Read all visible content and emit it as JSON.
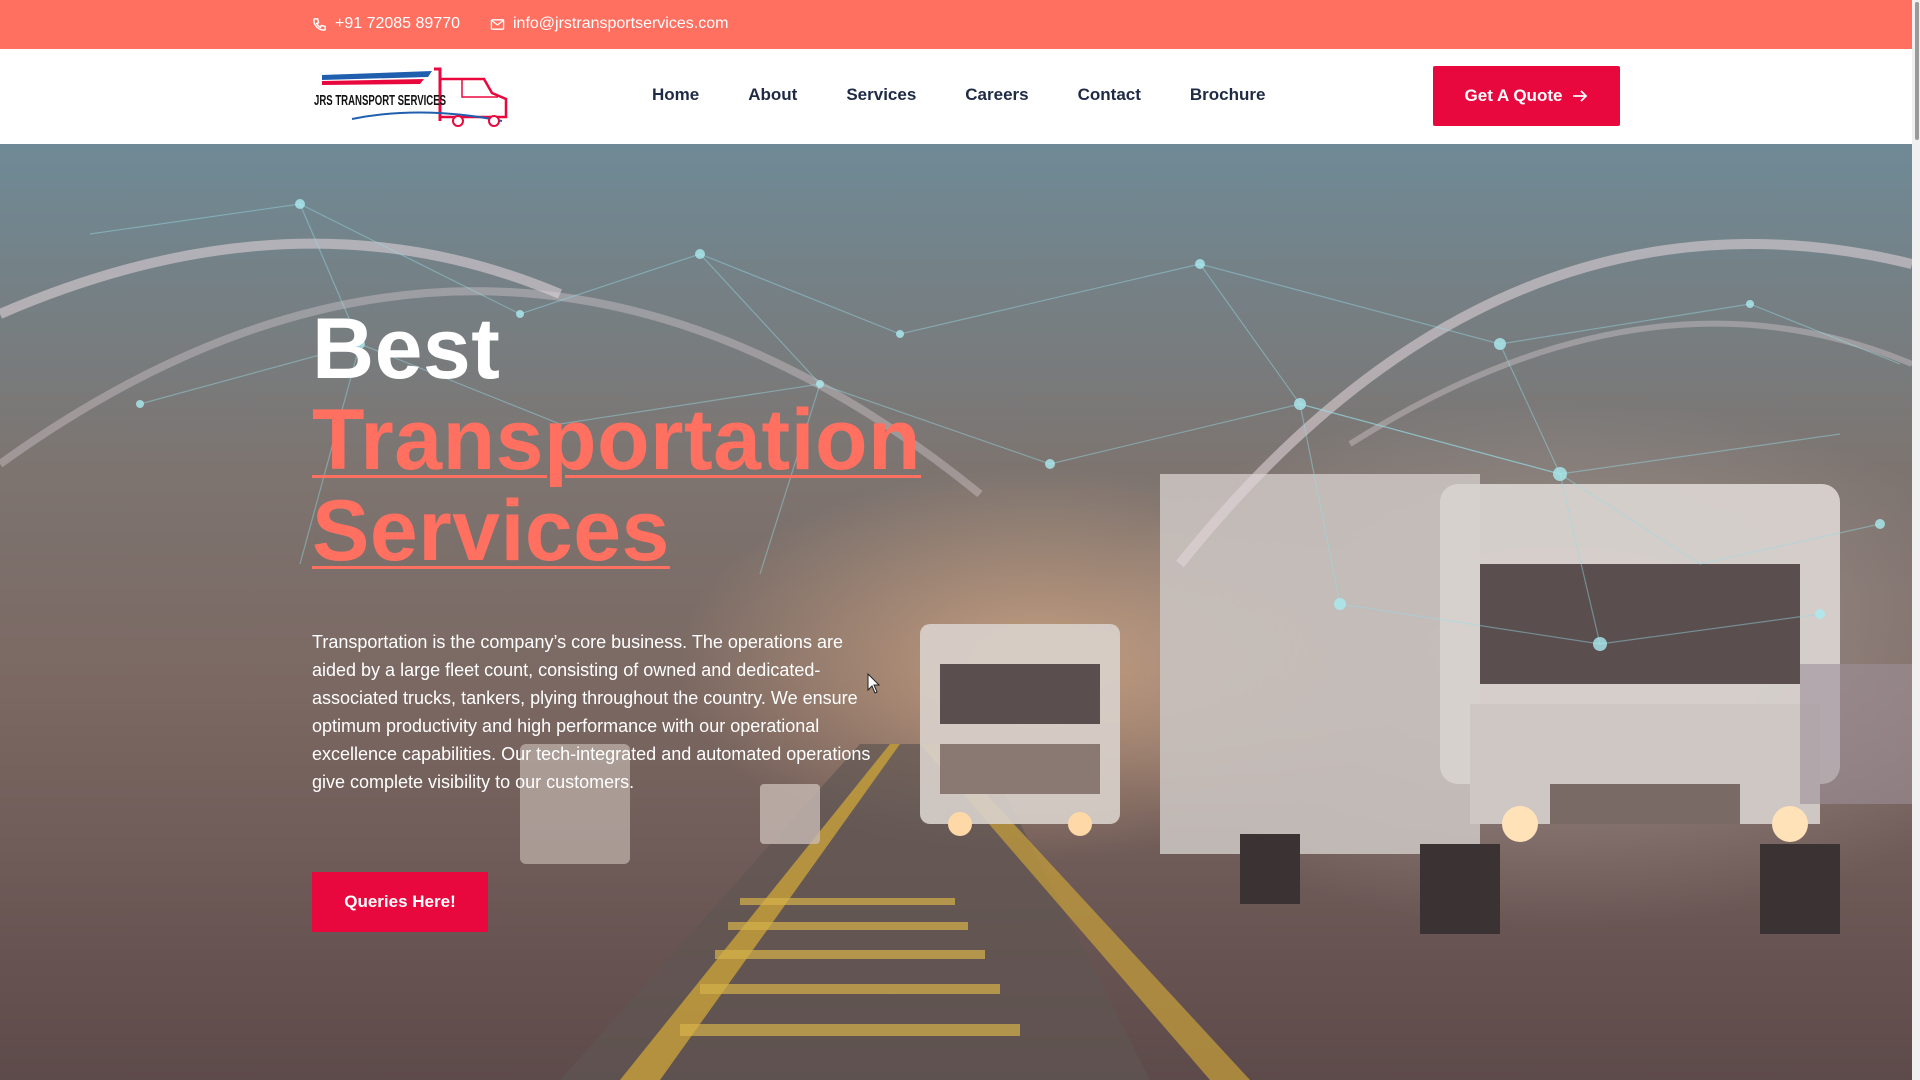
{
  "topbar": {
    "phone": "+91 72085 89770",
    "email": "info@jrstransportservices.com"
  },
  "header": {
    "logo_text": "JRS TRANSPORT SERVICES",
    "nav": [
      {
        "label": "Home"
      },
      {
        "label": "About"
      },
      {
        "label": "Services"
      },
      {
        "label": "Careers"
      },
      {
        "label": "Contact"
      },
      {
        "label": "Brochure"
      }
    ],
    "quote_button": "Get A Quote"
  },
  "hero": {
    "title_line1": "Best",
    "title_accent_line1": "Transportation",
    "title_accent_line2": "Services",
    "description": "Transportation is the company’s core business. The operations are aided by a large fleet count, consisting of owned and dedicated-associated trucks, tankers, plying throughout the country. We ensure optimum productivity and high performance with our operational excellence capabilities. Our tech-integrated and automated operations give complete visibility to our customers.",
    "cta_button": "Queries Here!"
  },
  "colors": {
    "topbar": "#ff7061",
    "accent": "#ff7061",
    "button": "#e8083e",
    "nav_text": "#1f2a44"
  },
  "icons": {
    "phone": "phone-icon",
    "email": "mail-icon",
    "quote_arrow": "arrow-right-icon"
  }
}
